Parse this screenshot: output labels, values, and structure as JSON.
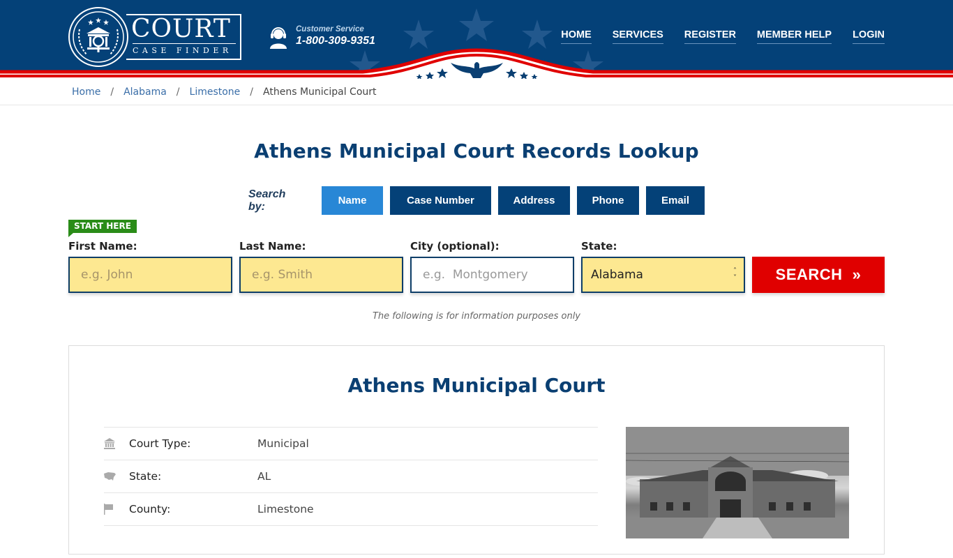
{
  "header": {
    "logo": {
      "title": "COURT",
      "subtitle": "CASE FINDER"
    },
    "customer_service": {
      "label": "Customer Service",
      "phone": "1-800-309-9351"
    },
    "nav": [
      {
        "label": "HOME"
      },
      {
        "label": "SERVICES"
      },
      {
        "label": "REGISTER"
      },
      {
        "label": "MEMBER HELP"
      },
      {
        "label": "LOGIN"
      }
    ]
  },
  "breadcrumb": {
    "items": [
      {
        "label": "Home"
      },
      {
        "label": "Alabama"
      },
      {
        "label": "Limestone"
      }
    ],
    "separator": "/",
    "current": "Athens Municipal Court"
  },
  "search": {
    "title": "Athens Municipal Court Records Lookup",
    "search_by_label": "Search by:",
    "tabs": [
      {
        "label": "Name",
        "active": true
      },
      {
        "label": "Case Number",
        "active": false
      },
      {
        "label": "Address",
        "active": false
      },
      {
        "label": "Phone",
        "active": false
      },
      {
        "label": "Email",
        "active": false
      }
    ],
    "start_here": "START HERE",
    "fields": {
      "first_name": {
        "label": "First Name:",
        "placeholder": "e.g. John",
        "value": ""
      },
      "last_name": {
        "label": "Last Name:",
        "placeholder": "e.g. Smith",
        "value": ""
      },
      "city": {
        "label": "City (optional):",
        "placeholder": "e.g.  Montgomery",
        "value": ""
      },
      "state": {
        "label": "State:",
        "selected": "Alabama"
      }
    },
    "button_label": "SEARCH",
    "button_icon": "»",
    "disclaimer": "The following is for information purposes only"
  },
  "court": {
    "name": "Athens Municipal Court",
    "details": [
      {
        "icon": "courthouse-icon",
        "key": "Court Type:",
        "value": "Municipal"
      },
      {
        "icon": "usa-map-icon",
        "key": "State:",
        "value": "AL"
      },
      {
        "icon": "flag-icon",
        "key": "County:",
        "value": "Limestone"
      }
    ]
  },
  "colors": {
    "brand_blue": "#044178",
    "active_tab": "#2887d6",
    "search_red": "#e00000",
    "start_green": "#2a8c18",
    "input_yellow": "#fde891"
  }
}
